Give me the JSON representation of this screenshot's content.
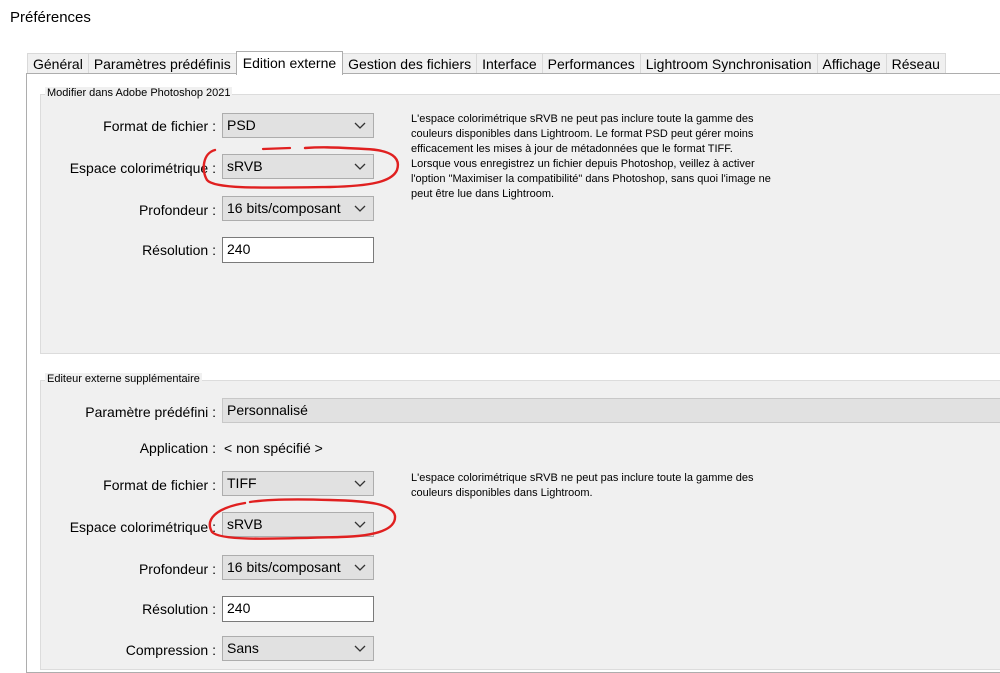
{
  "window": {
    "title": "Préférences"
  },
  "tabs": [
    {
      "label": "Général"
    },
    {
      "label": "Paramètres prédéfinis"
    },
    {
      "label": "Edition externe"
    },
    {
      "label": "Gestion des fichiers"
    },
    {
      "label": "Interface"
    },
    {
      "label": "Performances"
    },
    {
      "label": "Lightroom Synchronisation"
    },
    {
      "label": "Affichage"
    },
    {
      "label": "Réseau"
    }
  ],
  "photoshop_group": {
    "title": "Modifier dans Adobe Photoshop 2021",
    "file_format": {
      "label": "Format de fichier :",
      "value": "PSD"
    },
    "color_space": {
      "label": "Espace colorimétrique :",
      "value": "sRVB"
    },
    "bit_depth": {
      "label": "Profondeur :",
      "value": "16 bits/composant"
    },
    "resolution": {
      "label": "Résolution :",
      "value": "240"
    },
    "help_lines": [
      "L'espace colorimétrique sRVB ne peut pas inclure toute la gamme des",
      "couleurs disponibles dans Lightroom. Le format PSD peut gérer moins",
      "efficacement les mises à jour de métadonnées que le format TIFF.",
      "Lorsque vous enregistrez un fichier depuis Photoshop, veillez à activer",
      "l'option \"Maximiser la compatibilité\" dans Photoshop, sans quoi l'image ne",
      "peut être lue dans Lightroom."
    ]
  },
  "additional_group": {
    "title": "Editeur externe supplémentaire",
    "preset": {
      "label": "Paramètre prédéfini :",
      "value": "Personnalisé"
    },
    "application": {
      "label": "Application :",
      "value": "< non spécifié >"
    },
    "file_format": {
      "label": "Format de fichier :",
      "value": "TIFF"
    },
    "color_space": {
      "label": "Espace colorimétrique :",
      "value": "sRVB"
    },
    "bit_depth": {
      "label": "Profondeur :",
      "value": "16 bits/composant"
    },
    "resolution": {
      "label": "Résolution :",
      "value": "240"
    },
    "compression": {
      "label": "Compression :",
      "value": "Sans"
    },
    "help_lines": [
      "L'espace colorimétrique sRVB ne peut pas inclure toute la gamme des",
      "couleurs disponibles dans Lightroom."
    ]
  },
  "annotation_color": "#e02020"
}
